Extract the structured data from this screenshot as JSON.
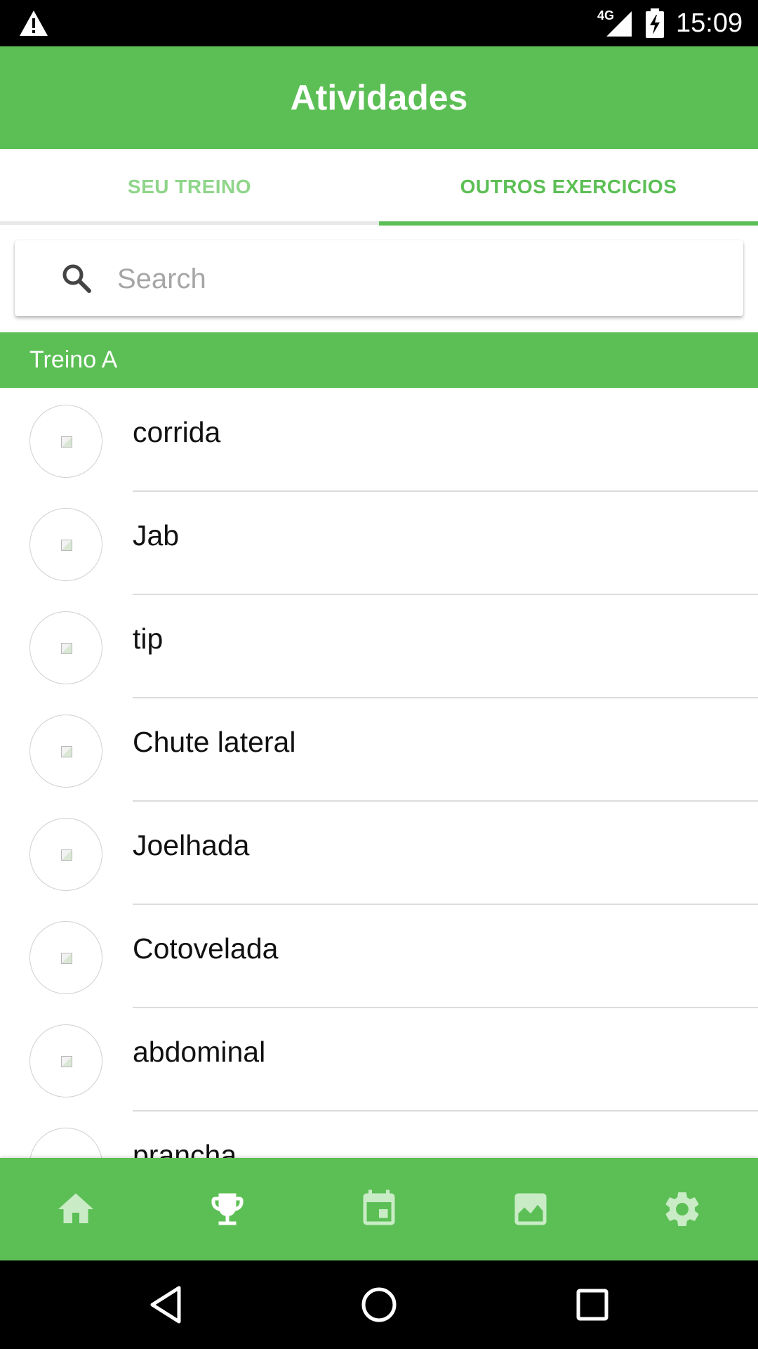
{
  "status_bar": {
    "time": "15:09",
    "network": "4G",
    "icons": [
      "warning-icon",
      "signal-icon",
      "battery-charging-icon"
    ]
  },
  "app_bar": {
    "title": "Atividades"
  },
  "tabs": [
    {
      "label": "SEU TREINO",
      "selected": false
    },
    {
      "label": "OUTROS EXERCICIOS",
      "selected": true
    }
  ],
  "search": {
    "placeholder": "Search",
    "value": "",
    "icon": "search-icon"
  },
  "section": {
    "title": "Treino A"
  },
  "exercises": [
    {
      "name": "corrida"
    },
    {
      "name": "Jab"
    },
    {
      "name": "tip"
    },
    {
      "name": "Chute lateral"
    },
    {
      "name": "Joelhada"
    },
    {
      "name": "Cotovelada"
    },
    {
      "name": "abdominal"
    },
    {
      "name": "prancha"
    }
  ],
  "bottom_nav": [
    {
      "icon": "home-icon"
    },
    {
      "icon": "trophy-icon"
    },
    {
      "icon": "calendar-icon"
    },
    {
      "icon": "chart-icon"
    },
    {
      "icon": "gear-icon"
    }
  ],
  "system_nav": [
    "back-icon",
    "home-circle-icon",
    "recents-icon"
  ],
  "colors": {
    "primary": "#5cbf55",
    "tab_inactive": "#8fd58a",
    "nav_icon": "#c9ecc6"
  }
}
